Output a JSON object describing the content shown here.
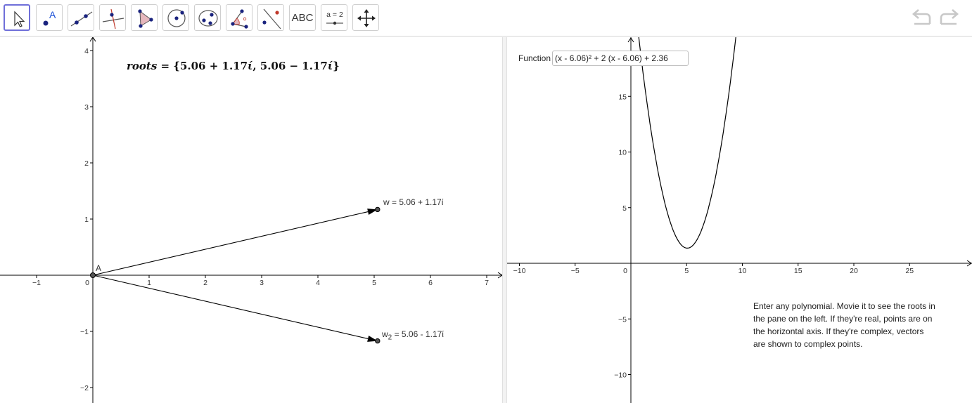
{
  "toolbar": {
    "tools": [
      {
        "name": "move-tool",
        "icon": "arrow-cursor-icon"
      },
      {
        "name": "point-tool",
        "icon": "point-icon",
        "label": "A"
      },
      {
        "name": "line-tool",
        "icon": "line-icon"
      },
      {
        "name": "perpendicular-line-tool",
        "icon": "perpendicular-icon"
      },
      {
        "name": "polygon-tool",
        "icon": "polygon-icon"
      },
      {
        "name": "circle-tool",
        "icon": "circle-center-icon"
      },
      {
        "name": "ellipse-tool",
        "icon": "ellipse-icon"
      },
      {
        "name": "angle-tool",
        "icon": "angle-icon"
      },
      {
        "name": "reflect-tool",
        "icon": "reflect-icon"
      },
      {
        "name": "text-tool",
        "icon": "text-icon",
        "label": "ABC"
      },
      {
        "name": "slider-tool",
        "icon": "slider-icon",
        "label": "a = 2"
      },
      {
        "name": "move-graphics-tool",
        "icon": "move-arrows-icon"
      }
    ],
    "selected_tool": "move-tool",
    "undo_icon": "undo-icon",
    "redo_icon": "redo-icon",
    "accent_color": "#6f6fd9"
  },
  "left_graphics": {
    "roots_prefix": "roots",
    "roots_eq": " = {5.06 + 1.17",
    "roots_i1": "ί",
    "roots_mid": ", 5.06 − 1.17",
    "roots_i2": "ί",
    "roots_close": "}",
    "x_ticks": [
      "−1",
      "0",
      "1",
      "2",
      "3",
      "4",
      "5",
      "6",
      "7"
    ],
    "y_ticks": [
      "4",
      "3",
      "2",
      "1",
      "−1",
      "−2"
    ],
    "origin_label": "A",
    "w_label": "w = 5.06 + 1.17ί",
    "w2_label_prefix": "w",
    "w2_label_sub": "2",
    "w2_label_rest": " = 5.06 - 1.17ί",
    "vectors": [
      {
        "name": "w",
        "re": 5.06,
        "im": 1.17
      },
      {
        "name": "w2",
        "re": 5.06,
        "im": -1.17
      }
    ]
  },
  "right_graphics": {
    "function_caption": "Function",
    "function_value": "(x - 6.06)² + 2 (x - 6.06) + 2.36",
    "x_ticks": [
      "−10",
      "−5",
      "0",
      "5",
      "10",
      "15",
      "20",
      "25"
    ],
    "y_ticks": [
      "15",
      "10",
      "5",
      "−5",
      "−10"
    ],
    "info_text": "Enter any polynomial. Movie it to see the roots in the pane on the left. If they're real, points are on the horizontal axis. If they're complex, vectors are shown to complex points.",
    "chart_data": {
      "type": "line",
      "series": [
        {
          "expression": "(x - 6.06)^2 + 2 (x - 6.06) + 2.36",
          "vertex": [
            5.06,
            1.37
          ]
        }
      ],
      "xlim": [
        -10.5,
        30
      ],
      "ylim": [
        -12,
        20
      ],
      "xlabel": "",
      "ylabel": "",
      "grid": false
    }
  }
}
